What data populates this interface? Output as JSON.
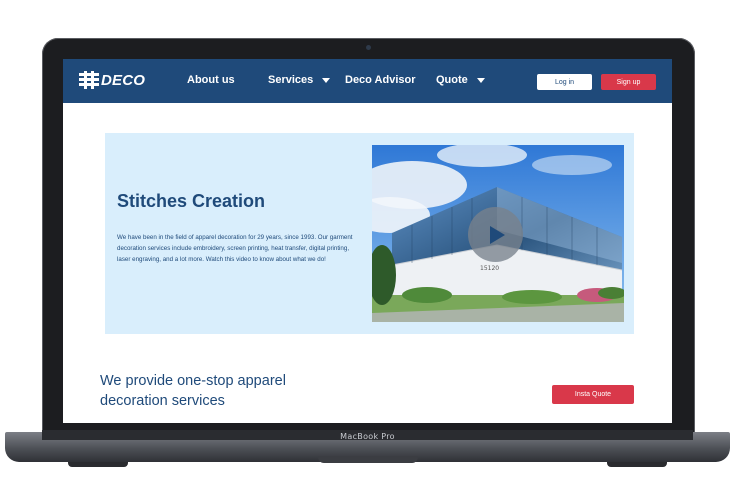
{
  "device": {
    "label": "MacBook Pro"
  },
  "nav": {
    "logo_text": "DECO",
    "items": [
      {
        "label": "About us",
        "has_dropdown": false
      },
      {
        "label": "Services",
        "has_dropdown": true
      },
      {
        "label": "Deco Advisor",
        "has_dropdown": false
      },
      {
        "label": "Quote",
        "has_dropdown": true
      }
    ],
    "login_label": "Log in",
    "signup_label": "Sign up"
  },
  "hero": {
    "title": "Stitches Creation",
    "body": "We have been in the field of apparel decoration for 29 years, since 1993. Our garment decoration services include embroidery, screen printing, heat transfer, digital printing, laser engraving, and a lot more. Watch this video to know about what we do!",
    "building_number": "15120",
    "play_icon": "play-icon"
  },
  "section": {
    "tagline_line1": "We provide one-stop apparel",
    "tagline_line2": "decoration services",
    "quote_label": "Insta Quote"
  },
  "colors": {
    "brand": "#1f4a7a",
    "accent": "#d9384a",
    "hero_bg": "#d9eefc"
  }
}
